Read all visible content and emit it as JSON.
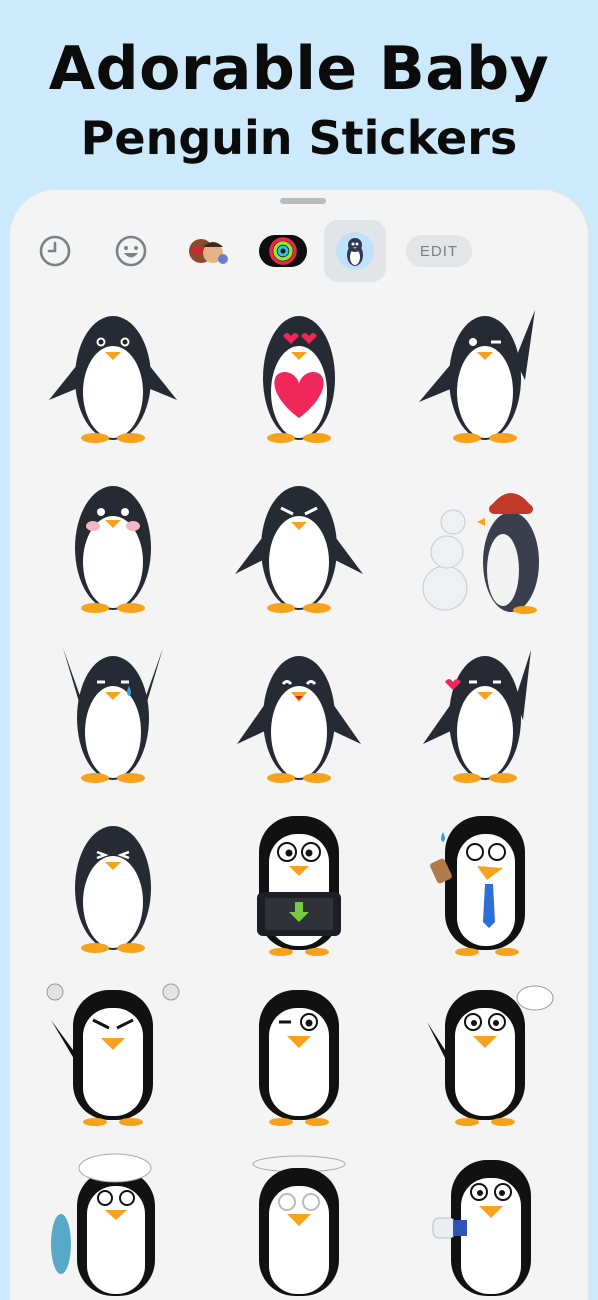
{
  "headline": {
    "line1": "Adorable Baby",
    "line2": "Penguin Stickers"
  },
  "toolbar": {
    "items": [
      {
        "name": "recents",
        "icon": "clock-icon"
      },
      {
        "name": "emoji",
        "icon": "smiley-icon"
      },
      {
        "name": "memoji",
        "icon": "memoji-icon"
      },
      {
        "name": "activity",
        "icon": "activity-rings-icon"
      },
      {
        "name": "penguin-pack",
        "icon": "penguin-pack-icon",
        "selected": true
      }
    ],
    "edit_label": "EDIT"
  },
  "stickers": [
    {
      "id": "s1",
      "icon": "penguin-sticker"
    },
    {
      "id": "s2",
      "icon": "penguin-heart-sticker"
    },
    {
      "id": "s3",
      "icon": "penguin-wave-wink-sticker"
    },
    {
      "id": "s4",
      "icon": "penguin-blush-sticker"
    },
    {
      "id": "s5",
      "icon": "penguin-angry-sticker"
    },
    {
      "id": "s6",
      "icon": "penguin-snowman-sticker"
    },
    {
      "id": "s7",
      "icon": "penguin-crying-wave-sticker"
    },
    {
      "id": "s8",
      "icon": "penguin-laugh-sticker"
    },
    {
      "id": "s9",
      "icon": "penguin-kiss-sticker"
    },
    {
      "id": "s10",
      "icon": "penguin-squint-sticker"
    },
    {
      "id": "s11",
      "icon": "penguin-download-sticker"
    },
    {
      "id": "s12",
      "icon": "penguin-tie-sweat-sticker"
    },
    {
      "id": "s13",
      "icon": "penguin-furious-sticker"
    },
    {
      "id": "s14",
      "icon": "penguin-wink-sticker"
    },
    {
      "id": "s15",
      "icon": "penguin-speech-bubble-sticker"
    },
    {
      "id": "s16",
      "icon": "penguin-chef-fish-sticker"
    },
    {
      "id": "s17",
      "icon": "penguin-dizzy-sticker"
    },
    {
      "id": "s18",
      "icon": "penguin-thumbs-up-sticker"
    }
  ],
  "colors": {
    "background": "#cdeafc",
    "sheet": "#f3f4f3",
    "penguin_dark": "#262a33",
    "beak": "#f7a21c",
    "heart": "#f0285a"
  }
}
